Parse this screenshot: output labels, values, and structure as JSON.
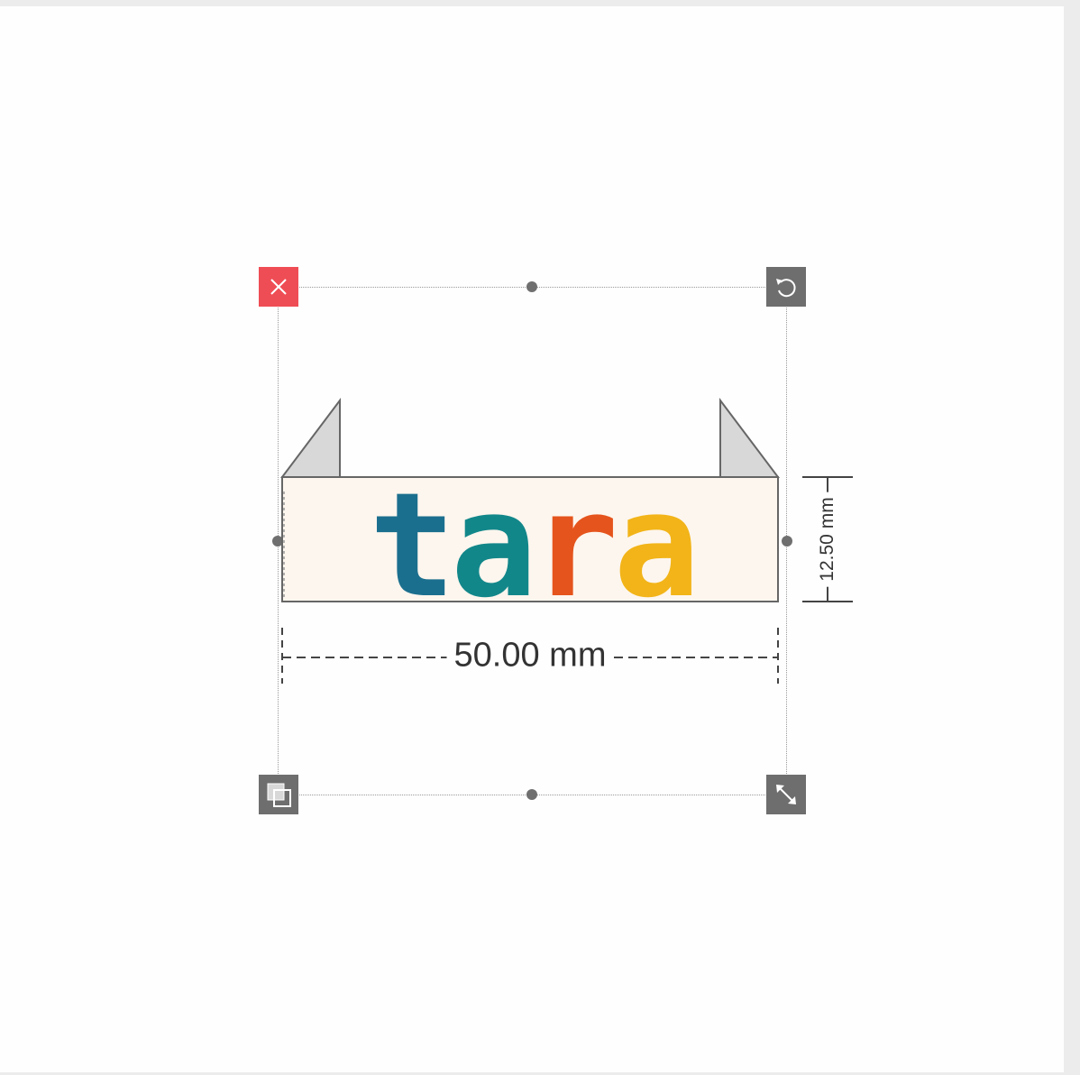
{
  "label": {
    "text": "tara",
    "letters": [
      {
        "char": "t",
        "color": "#1b6f8e"
      },
      {
        "char": "a",
        "color": "#12878a"
      },
      {
        "char": "r",
        "color": "#e5541c"
      },
      {
        "char": "a",
        "color": "#f2b418"
      }
    ],
    "background_color": "#fdf6ee",
    "tab_color": "#d8d8d8"
  },
  "dimensions": {
    "width_label": "50.00 mm",
    "height_label": "12.50 mm"
  },
  "controls": {
    "delete_icon": "close-icon",
    "rotate_icon": "rotate-icon",
    "layer_icon": "layer-icon",
    "resize_icon": "resize-icon"
  },
  "colors": {
    "delete": "#ef4d55",
    "handle": "#6e6e6e"
  }
}
